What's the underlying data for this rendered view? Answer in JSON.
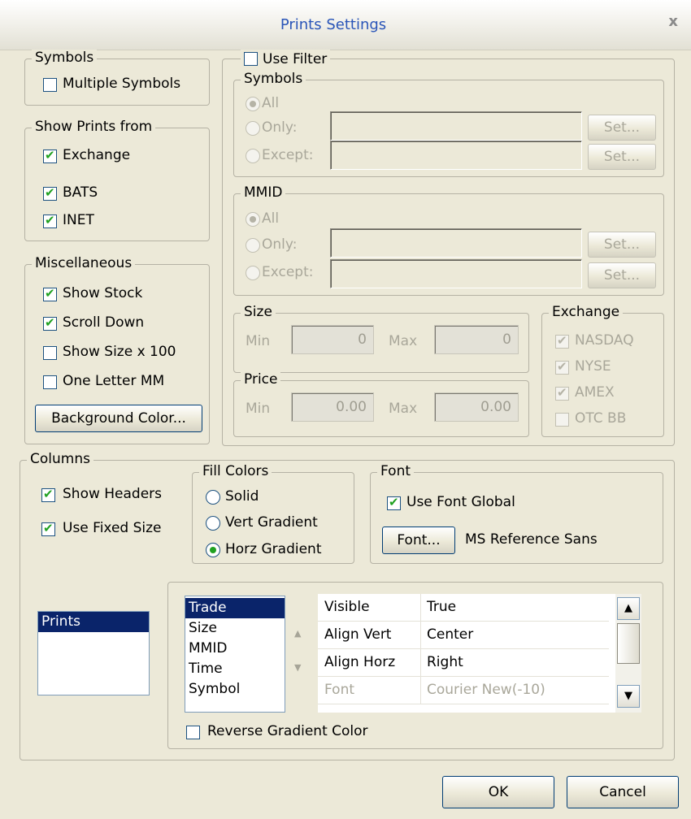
{
  "window": {
    "title": "Prints Settings",
    "close_icon": "close-icon"
  },
  "symbols_group": {
    "legend": "Symbols",
    "multiple_symbols": {
      "label": "Multiple Symbols",
      "checked": false
    }
  },
  "show_prints": {
    "legend": "Show Prints from",
    "items": [
      {
        "label": "Exchange",
        "checked": true
      },
      {
        "label": "BATS",
        "checked": true
      },
      {
        "label": "INET",
        "checked": true
      }
    ]
  },
  "misc": {
    "legend": "Miscellaneous",
    "items": [
      {
        "label": "Show Stock",
        "checked": true
      },
      {
        "label": "Scroll Down",
        "checked": true
      },
      {
        "label": "Show Size x 100",
        "checked": false
      },
      {
        "label": "One Letter MM",
        "checked": false
      }
    ],
    "background_button": "Background Color..."
  },
  "filter": {
    "use_filter": {
      "label": "Use Filter",
      "checked": false
    },
    "symbols": {
      "legend": "Symbols",
      "all": "All",
      "only": "Only:",
      "except": "Except:",
      "only_value": "",
      "except_value": "",
      "set_label": "Set..."
    },
    "mmid": {
      "legend": "MMID",
      "all": "All",
      "only": "Only:",
      "except": "Except:",
      "only_value": "",
      "except_value": "",
      "set_label": "Set..."
    },
    "size": {
      "legend": "Size",
      "min_label": "Min",
      "max_label": "Max",
      "min_value": "0",
      "max_value": "0"
    },
    "price": {
      "legend": "Price",
      "min_label": "Min",
      "max_label": "Max",
      "min_value": "0.00",
      "max_value": "0.00"
    },
    "exchange": {
      "legend": "Exchange",
      "items": [
        {
          "label": "NASDAQ",
          "checked": true
        },
        {
          "label": "NYSE",
          "checked": true
        },
        {
          "label": "AMEX",
          "checked": true
        },
        {
          "label": "OTC BB",
          "checked": false
        }
      ]
    }
  },
  "columns": {
    "legend": "Columns",
    "show_headers": {
      "label": "Show Headers",
      "checked": true
    },
    "use_fixed_size": {
      "label": "Use Fixed Size",
      "checked": true
    },
    "fill_colors": {
      "legend": "Fill Colors",
      "options": [
        "Solid",
        "Vert Gradient",
        "Horz Gradient"
      ],
      "selected": "Horz Gradient"
    },
    "font": {
      "legend": "Font",
      "use_font_global": {
        "label": "Use Font Global",
        "checked": true
      },
      "font_button": "Font...",
      "font_name": "MS Reference Sans"
    },
    "windows_list": {
      "items": [
        "Prints"
      ],
      "selected": "Prints"
    },
    "column_list": {
      "items": [
        "Trade",
        "Size",
        "MMID",
        "Time",
        "Symbol"
      ],
      "selected": "Trade"
    },
    "properties": [
      {
        "key": "Visible",
        "value": "True",
        "disabled": false
      },
      {
        "key": "Align Vert",
        "value": "Center",
        "disabled": false
      },
      {
        "key": "Align Horz",
        "value": "Right",
        "disabled": false
      },
      {
        "key": "Font",
        "value": "Courier New(-10)",
        "disabled": true
      }
    ],
    "reverse_gradient": {
      "label": "Reverse Gradient Color",
      "checked": false
    }
  },
  "footer": {
    "ok": "OK",
    "cancel": "Cancel"
  }
}
